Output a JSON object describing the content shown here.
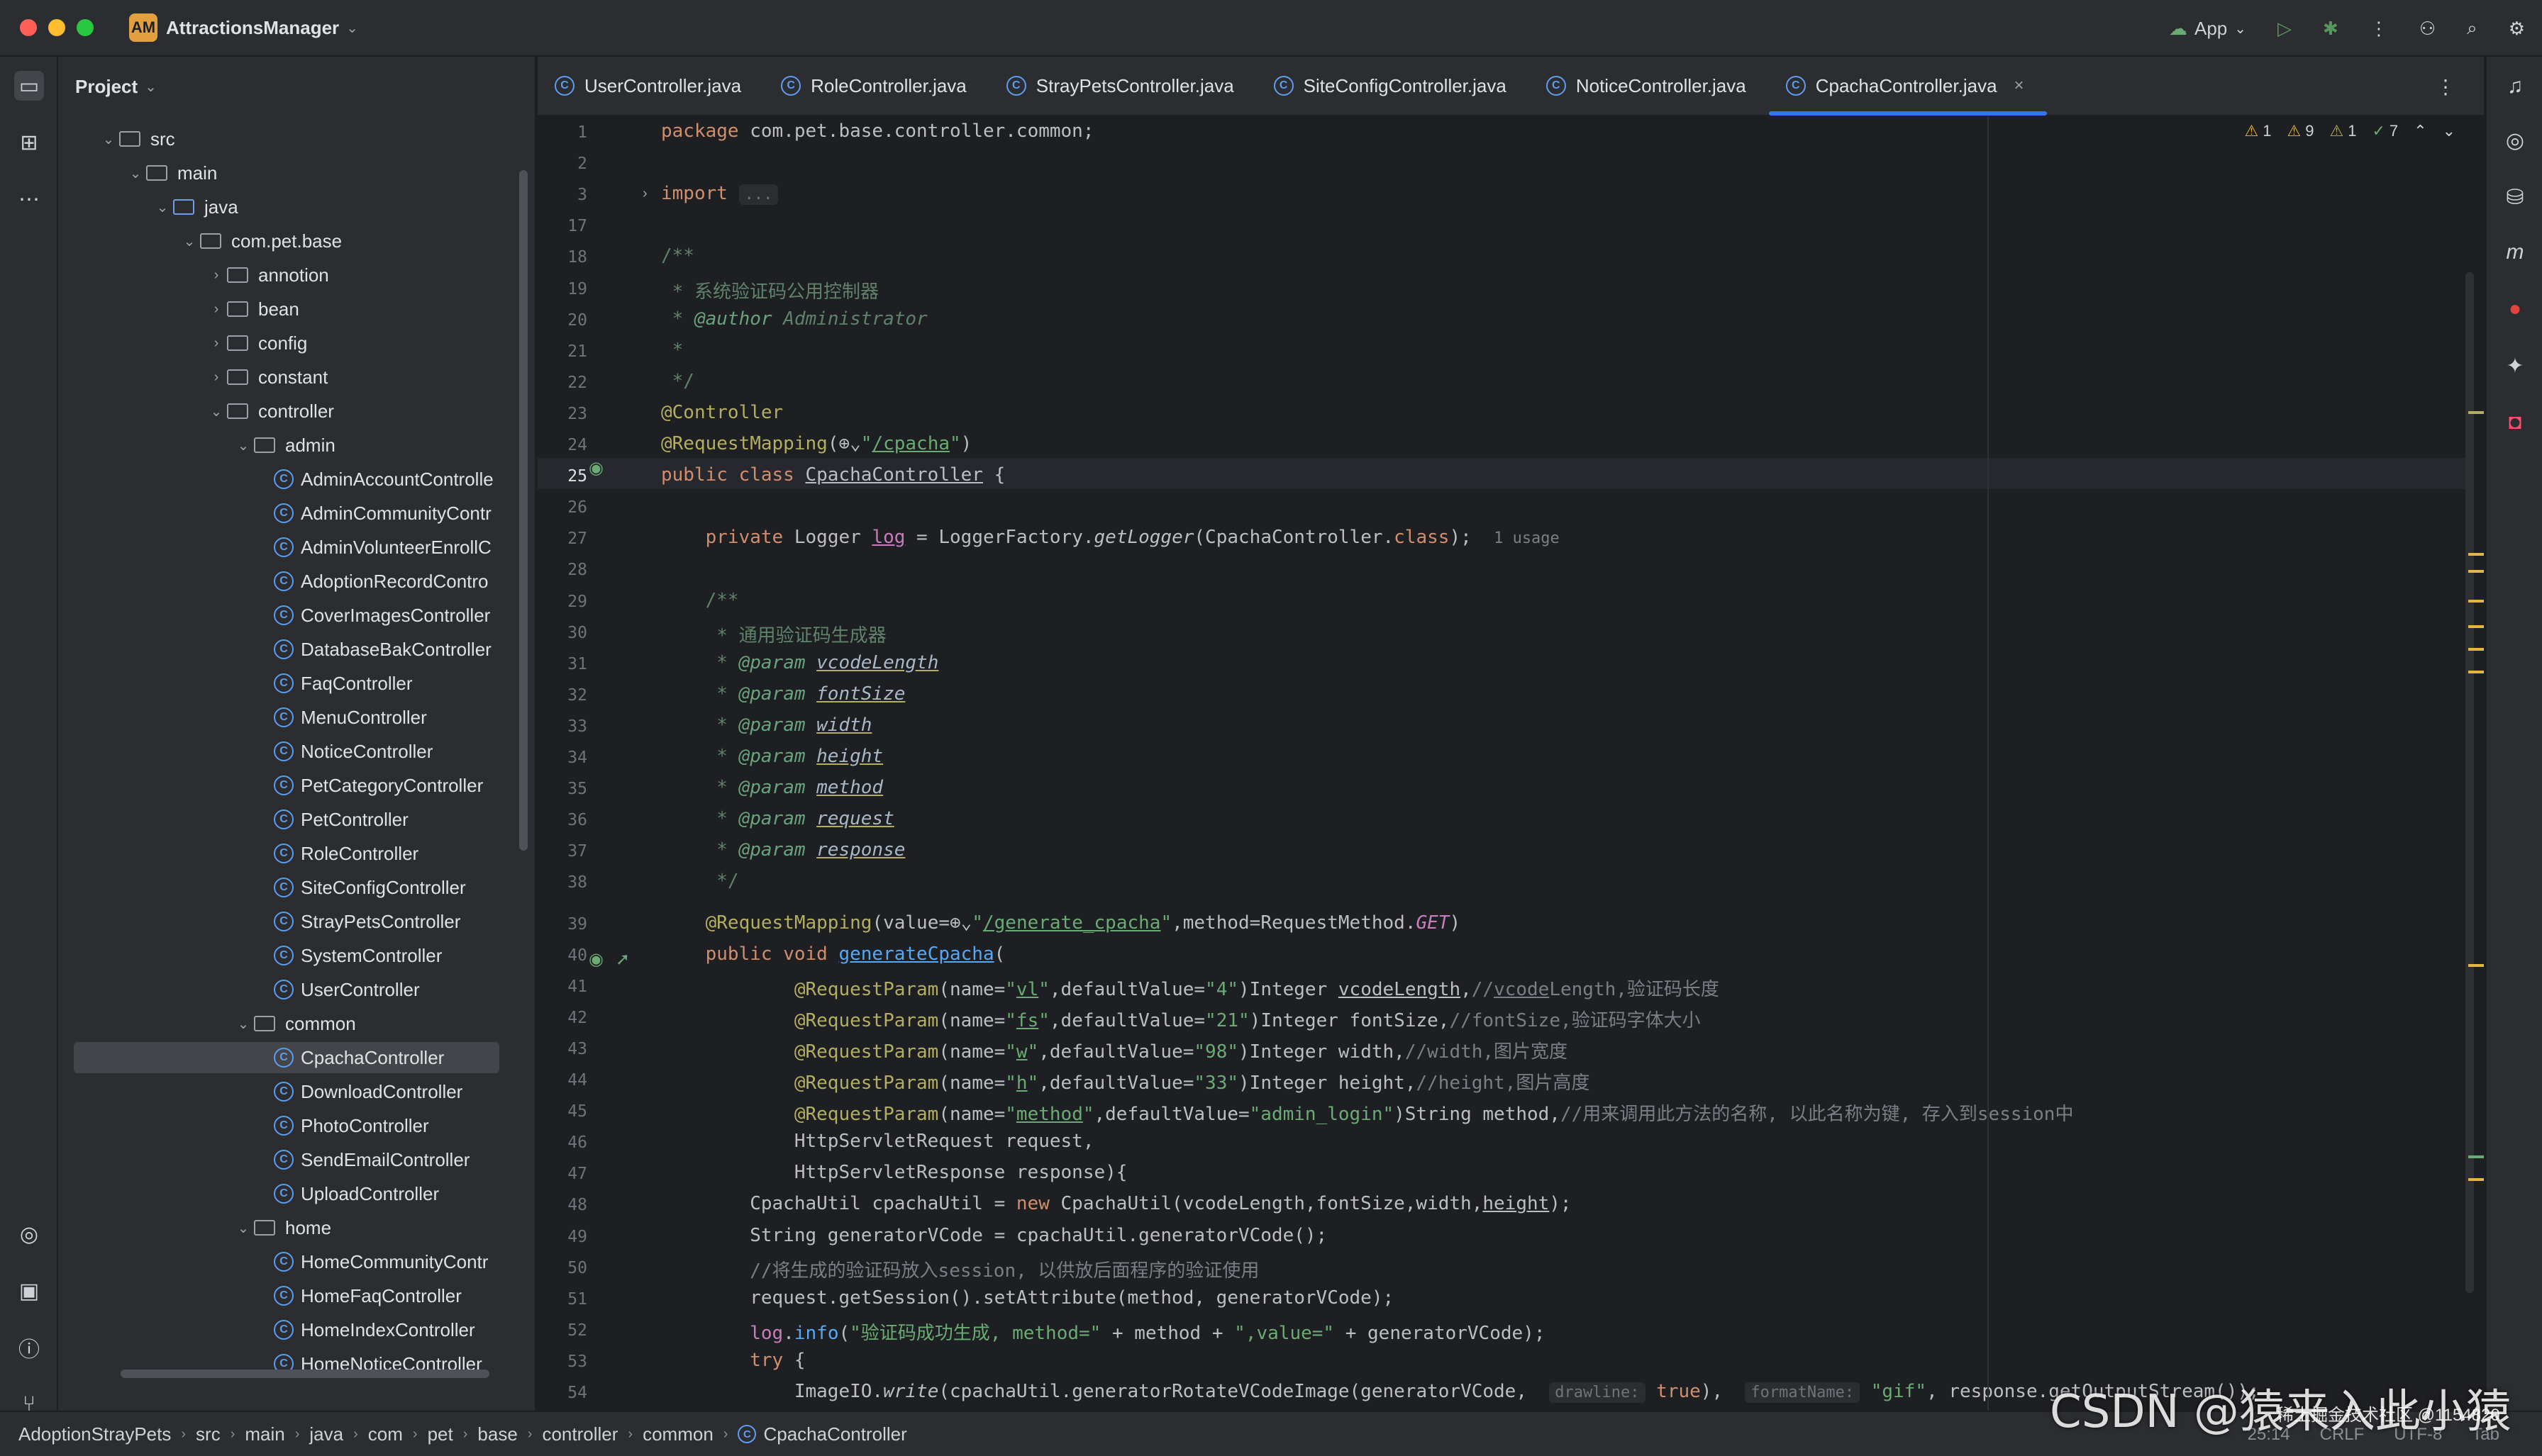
{
  "titlebar": {
    "project_badge": "AM",
    "project_name": "AttractionsManager",
    "run_config": "App"
  },
  "project_panel": {
    "title": "Project",
    "tree": [
      {
        "label": "src",
        "depth": 0,
        "type": "folder",
        "expanded": true
      },
      {
        "label": "main",
        "depth": 1,
        "type": "folder",
        "expanded": true
      },
      {
        "label": "java",
        "depth": 2,
        "type": "folder-blue",
        "expanded": true
      },
      {
        "label": "com.pet.base",
        "depth": 3,
        "type": "folder",
        "expanded": true
      },
      {
        "label": "annotion",
        "depth": 4,
        "type": "folder",
        "expanded": false
      },
      {
        "label": "bean",
        "depth": 4,
        "type": "folder",
        "expanded": false
      },
      {
        "label": "config",
        "depth": 4,
        "type": "folder",
        "expanded": false
      },
      {
        "label": "constant",
        "depth": 4,
        "type": "folder",
        "expanded": false
      },
      {
        "label": "controller",
        "depth": 4,
        "type": "folder",
        "expanded": true
      },
      {
        "label": "admin",
        "depth": 5,
        "type": "folder",
        "expanded": true
      },
      {
        "label": "AdminAccountControlle",
        "depth": 6,
        "type": "class"
      },
      {
        "label": "AdminCommunityContr",
        "depth": 6,
        "type": "class"
      },
      {
        "label": "AdminVolunteerEnrollC",
        "depth": 6,
        "type": "class"
      },
      {
        "label": "AdoptionRecordContro",
        "depth": 6,
        "type": "class"
      },
      {
        "label": "CoverImagesController",
        "depth": 6,
        "type": "class"
      },
      {
        "label": "DatabaseBakController",
        "depth": 6,
        "type": "class"
      },
      {
        "label": "FaqController",
        "depth": 6,
        "type": "class"
      },
      {
        "label": "MenuController",
        "depth": 6,
        "type": "class"
      },
      {
        "label": "NoticeController",
        "depth": 6,
        "type": "class"
      },
      {
        "label": "PetCategoryController",
        "depth": 6,
        "type": "class"
      },
      {
        "label": "PetController",
        "depth": 6,
        "type": "class"
      },
      {
        "label": "RoleController",
        "depth": 6,
        "type": "class"
      },
      {
        "label": "SiteConfigController",
        "depth": 6,
        "type": "class"
      },
      {
        "label": "StrayPetsController",
        "depth": 6,
        "type": "class"
      },
      {
        "label": "SystemController",
        "depth": 6,
        "type": "class"
      },
      {
        "label": "UserController",
        "depth": 6,
        "type": "class"
      },
      {
        "label": "common",
        "depth": 5,
        "type": "folder",
        "expanded": true
      },
      {
        "label": "CpachaController",
        "depth": 6,
        "type": "class",
        "selected": true
      },
      {
        "label": "DownloadController",
        "depth": 6,
        "type": "class"
      },
      {
        "label": "PhotoController",
        "depth": 6,
        "type": "class"
      },
      {
        "label": "SendEmailController",
        "depth": 6,
        "type": "class"
      },
      {
        "label": "UploadController",
        "depth": 6,
        "type": "class"
      },
      {
        "label": "home",
        "depth": 5,
        "type": "folder",
        "expanded": true
      },
      {
        "label": "HomeCommunityContr",
        "depth": 6,
        "type": "class"
      },
      {
        "label": "HomeFaqController",
        "depth": 6,
        "type": "class"
      },
      {
        "label": "HomeIndexController",
        "depth": 6,
        "type": "class"
      },
      {
        "label": "HomeNoticeController",
        "depth": 6,
        "type": "class"
      }
    ]
  },
  "tabs": [
    {
      "label": "UserController.java",
      "active": false
    },
    {
      "label": "RoleController.java",
      "active": false
    },
    {
      "label": "StrayPetsController.java",
      "active": false
    },
    {
      "label": "SiteConfigController.java",
      "active": false
    },
    {
      "label": "NoticeController.java",
      "active": false
    },
    {
      "label": "CpachaController.java",
      "active": true
    }
  ],
  "inspections": {
    "warn1": "1",
    "warn2": "9",
    "warn3": "1",
    "ok": "7"
  },
  "editor": {
    "current_line": "25",
    "lines": [
      {
        "n": "1",
        "html": "<span class='kw'>package</span> com.pet.base.controller.common;"
      },
      {
        "n": "2",
        "html": ""
      },
      {
        "n": "3",
        "html": "<span class='kw'>import</span> <span class='hint'>...</span>"
      },
      {
        "n": "17",
        "html": ""
      },
      {
        "n": "18",
        "html": "<span class='doc'>/**</span>"
      },
      {
        "n": "19",
        "html": "<span class='doc'> * 系统验证码公用控制器</span>"
      },
      {
        "n": "20",
        "html": "<span class='doc'> * </span><span class='doctag'>@author</span><span class='doc ital'> Administrator</span>"
      },
      {
        "n": "21",
        "html": "<span class='doc'> *</span>"
      },
      {
        "n": "22",
        "html": "<span class='doc'> */</span>"
      },
      {
        "n": "23",
        "html": "<span class='ann'>@Controller</span>"
      },
      {
        "n": "24",
        "html": "<span class='ann'>@RequestMapping</span>(⊕⌄<span class='str'>\"<u>/cpacha</u>\"</span>)"
      },
      {
        "n": "25",
        "html": "<span class='kw'>public class</span> <u>CpachaController</u> {"
      },
      {
        "n": "26",
        "html": ""
      },
      {
        "n": "27",
        "html": "    <span class='kw'>private</span> Logger <span class='fld'><u>log</u></span> = LoggerFactory.<span class='ital'>getLogger</span>(CpachaController.<span class='kw'>class</span>);  <span class='cmt' style='font-size:22px'>1 usage</span>"
      },
      {
        "n": "28",
        "html": ""
      },
      {
        "n": "29",
        "html": "    <span class='doc'>/**</span>"
      },
      {
        "n": "30",
        "html": "<span class='doc'>     * 通用验证码生成器</span>"
      },
      {
        "n": "31",
        "html": "<span class='doc'>     * </span><span class='doctag'>@param</span> <span class='docparam'>vcodeLength</span>"
      },
      {
        "n": "32",
        "html": "<span class='doc'>     * </span><span class='doctag'>@param</span> <span class='docparam'>fontSize</span>"
      },
      {
        "n": "33",
        "html": "<span class='doc'>     * </span><span class='doctag'>@param</span> <span class='docparam'>width</span>"
      },
      {
        "n": "34",
        "html": "<span class='doc'>     * </span><span class='doctag'>@param</span> <span class='docparam'>height</span>"
      },
      {
        "n": "35",
        "html": "<span class='doc'>     * </span><span class='doctag'>@param</span> <span class='docparam'>method</span>"
      },
      {
        "n": "36",
        "html": "<span class='doc'>     * </span><span class='doctag'>@param</span> <span class='docparam'>request</span>"
      },
      {
        "n": "37",
        "html": "<span class='doc'>     * </span><span class='doctag'>@param</span> <span class='docparam'>response</span>"
      },
      {
        "n": "38",
        "html": "<span class='doc'>     */</span>"
      },
      {
        "n": "39",
        "html": "    <span class='ann'>@RequestMapping</span>(value=⊕⌄<span class='str'>\"<u>/generate_cpacha</u>\"</span>,method=RequestMethod.<span class='fld ital'>GET</span>)"
      },
      {
        "n": "40",
        "html": "    <span class='kw'>public void</span> <span class='fn'><u>generateCpacha</u></span>("
      },
      {
        "n": "41",
        "html": "            <span class='ann'>@RequestParam</span>(name=<span class='str'>\"<u>vl</u>\"</span>,defaultValue=<span class='str'>\"4\"</span>)Integer <u>vcodeLength</u>,<span class='cmt'>//<u>vcode</u>Length,验证码长度</span>"
      },
      {
        "n": "42",
        "html": "            <span class='ann'>@RequestParam</span>(name=<span class='str'>\"<u>fs</u>\"</span>,defaultValue=<span class='str'>\"21\"</span>)Integer fontSize,<span class='cmt'>//fontSize,验证码字体大小</span>"
      },
      {
        "n": "43",
        "html": "            <span class='ann'>@RequestParam</span>(name=<span class='str'>\"<u>w</u>\"</span>,defaultValue=<span class='str'>\"98\"</span>)Integer width,<span class='cmt'>//width,图片宽度</span>"
      },
      {
        "n": "44",
        "html": "            <span class='ann'>@RequestParam</span>(name=<span class='str'>\"<u>h</u>\"</span>,defaultValue=<span class='str'>\"33\"</span>)Integer height,<span class='cmt'>//height,图片高度</span>"
      },
      {
        "n": "45",
        "html": "            <span class='ann'>@RequestParam</span>(name=<span class='str'>\"<u>method</u>\"</span>,defaultValue=<span class='str'>\"admin_login\"</span>)String method,<span class='cmt'>//用来调用此方法的名称, 以此名称为键, 存入到session中</span>"
      },
      {
        "n": "46",
        "html": "            HttpServletRequest request,"
      },
      {
        "n": "47",
        "html": "            HttpServletResponse response){"
      },
      {
        "n": "48",
        "html": "        CpachaUtil cpachaUtil = <span class='kw'>new</span> CpachaUtil(vcodeLength,fontSize,width,<u>height</u>);"
      },
      {
        "n": "49",
        "html": "        String generatorVCode = cpachaUtil.generatorVCode();"
      },
      {
        "n": "50",
        "html": "        <span class='cmt'>//将生成的验证码放入session, 以供放后面程序的验证使用</span>"
      },
      {
        "n": "51",
        "html": "        request.getSession().setAttribute(method, generatorVCode);"
      },
      {
        "n": "52",
        "html": "        <span class='fld'>log</span>.<span class='fn'>info</span>(<span class='str'>\"验证码成功生成, method=\"</span> + method + <span class='str'>\",value=\"</span> + generatorVCode);"
      },
      {
        "n": "53",
        "html": "        <span class='kw'>try</span> {"
      },
      {
        "n": "54",
        "html": "            ImageIO.<span class='ital'>write</span>(cpachaUtil.generatorRotateVCodeImage(generatorVCode,  <span class='hint'>drawline:</span> <span class='kw'>true</span>),  <span class='hint'>formatName:</span> <span class='str'>\"gif\"</span>, response.getOutputStream());"
      }
    ]
  },
  "breadcrumb": [
    "AdoptionStrayPets",
    "src",
    "main",
    "java",
    "com",
    "pet",
    "base",
    "controller",
    "common",
    "CpachaController"
  ],
  "status": {
    "position": "25:14",
    "line_sep": "CRLF",
    "encoding": "UTF-8",
    "indent": "Tab"
  },
  "watermark": {
    "main": "CSDN @猿来入此小猿",
    "sub": "稀土掘金技术社区 @1154820"
  }
}
